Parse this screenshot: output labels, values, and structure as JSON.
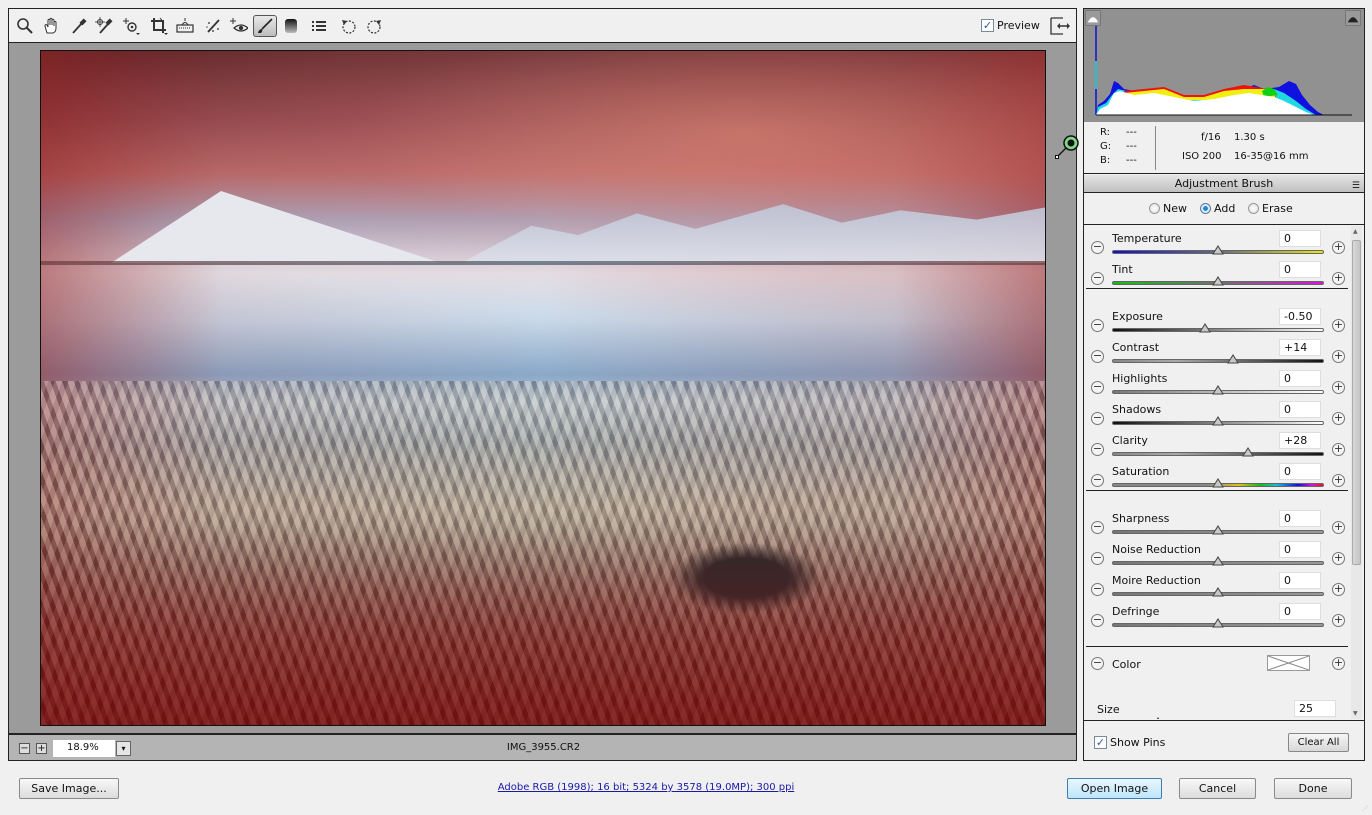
{
  "toolbar": {
    "tools": [
      {
        "name": "zoom-tool",
        "icon": "magnifier-icon"
      },
      {
        "name": "hand-tool",
        "icon": "hand-icon"
      },
      {
        "name": "white-balance-tool",
        "icon": "eyedropper-icon"
      },
      {
        "name": "color-sampler-tool",
        "icon": "color-sampler-icon"
      },
      {
        "name": "targeted-adjustment-tool",
        "icon": "target-adjust-icon"
      },
      {
        "name": "crop-tool",
        "icon": "crop-icon"
      },
      {
        "name": "straighten-tool",
        "icon": "level-icon"
      },
      {
        "name": "spot-removal-tool",
        "icon": "spot-brush-icon"
      },
      {
        "name": "red-eye-tool",
        "icon": "eye-icon"
      },
      {
        "name": "adjustment-brush-tool",
        "icon": "brush-icon",
        "active": true
      },
      {
        "name": "graduated-filter-tool",
        "icon": "gradient-icon"
      },
      {
        "name": "preferences",
        "icon": "list-icon"
      },
      {
        "name": "rotate-ccw",
        "icon": "rotate-left-icon"
      },
      {
        "name": "rotate-cw",
        "icon": "rotate-right-icon"
      }
    ],
    "preview_label": "Preview",
    "preview_checked": true
  },
  "statusbar": {
    "zoom_out": "−",
    "zoom_in": "+",
    "zoom_value": "18.9%",
    "zoom_dropdown": "▾",
    "filename": "IMG_3955.CR2"
  },
  "exif": {
    "r_label": "R:",
    "r_value": "---",
    "g_label": "G:",
    "g_value": "---",
    "b_label": "B:",
    "b_value": "---",
    "aperture": "f/16",
    "shutter": "1.30 s",
    "iso": "ISO 200",
    "lens": "16-35@16 mm"
  },
  "panel": {
    "title": "Adjustment Brush",
    "menu_icon": "☰",
    "modes": [
      {
        "label": "New",
        "selected": false
      },
      {
        "label": "Add",
        "selected": true
      },
      {
        "label": "Erase",
        "selected": false
      }
    ],
    "sliders": [
      {
        "label": "Temperature",
        "value": "0",
        "position": 0.5,
        "track": "temp"
      },
      {
        "label": "Tint",
        "value": "0",
        "position": 0.5,
        "track": "tint"
      },
      {
        "label": "Exposure",
        "value": "-0.50",
        "position": 0.44,
        "track": "exposure"
      },
      {
        "label": "Contrast",
        "value": "+14",
        "position": 0.57,
        "track": "contrast"
      },
      {
        "label": "Highlights",
        "value": "0",
        "position": 0.5,
        "track": "highlights"
      },
      {
        "label": "Shadows",
        "value": "0",
        "position": 0.5,
        "track": "shadows"
      },
      {
        "label": "Clarity",
        "value": "+28",
        "position": 0.64,
        "track": "contrast"
      },
      {
        "label": "Saturation",
        "value": "0",
        "position": 0.5,
        "track": "saturation"
      },
      {
        "label": "Sharpness",
        "value": "0",
        "position": 0.5,
        "track": "neutral"
      },
      {
        "label": "Noise Reduction",
        "value": "0",
        "position": 0.5,
        "track": "neutral"
      },
      {
        "label": "Moire Reduction",
        "value": "0",
        "position": 0.5,
        "track": "neutral"
      },
      {
        "label": "Defringe",
        "value": "0",
        "position": 0.5,
        "track": "neutral"
      }
    ],
    "color_label": "Color",
    "size_label": "Size",
    "size_value": "25",
    "size_position": 0.25,
    "show_pins_label": "Show Pins",
    "show_pins_checked": true,
    "clear_all_label": "Clear All"
  },
  "footer": {
    "save_image": "Save Image...",
    "workflow_info": "Adobe RGB (1998); 16 bit; 5324 by 3578 (19.0MP); 300 ppi",
    "open_image": "Open Image",
    "cancel": "Cancel",
    "done": "Done"
  },
  "colors": {
    "accent_link": "#1a1aa6",
    "pin_green": "#7fd88a",
    "mask_overlay": "#a01e1e"
  }
}
